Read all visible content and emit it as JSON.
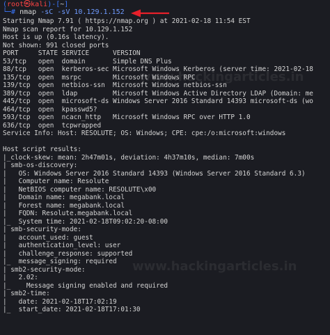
{
  "prompt": {
    "line1_open": "(",
    "user": "root㉿kali",
    "line1_mid": ")-[",
    "path": "~",
    "line1_close": "]",
    "line2_prefix": "└─# ",
    "command": "nmap",
    "args": " -sC -sV 10.129.1.152"
  },
  "colors": {
    "background": "#1b1c22",
    "text": "#d4d4d4",
    "prompt_blue": "#3b78ff",
    "prompt_user_red": "#ff4444",
    "arrow_red": "#e8202a"
  },
  "output_lines": [
    "Starting Nmap 7.91 ( https://nmap.org ) at 2021-02-18 11:54 EST",
    "Nmap scan report for 10.129.1.152",
    "Host is up (0.16s latency).",
    "Not shown: 991 closed ports",
    "PORT     STATE SERVICE      VERSION",
    "53/tcp   open  domain       Simple DNS Plus",
    "88/tcp   open  kerberos-sec Microsoft Windows Kerberos (server time: 2021-02-18",
    "135/tcp  open  msrpc        Microsoft Windows RPC",
    "139/tcp  open  netbios-ssn  Microsoft Windows netbios-ssn",
    "389/tcp  open  ldap         Microsoft Windows Active Directory LDAP (Domain: me",
    "445/tcp  open  microsoft-ds Windows Server 2016 Standard 14393 microsoft-ds (wo",
    "464/tcp  open  kpasswd5?",
    "593/tcp  open  ncacn_http   Microsoft Windows RPC over HTTP 1.0",
    "636/tcp  open  tcpwrapped",
    "Service Info: Host: RESOLUTE; OS: Windows; CPE: cpe:/o:microsoft:windows",
    "",
    "Host script results:",
    "|_clock-skew: mean: 2h47m01s, deviation: 4h37m10s, median: 7m00s",
    "| smb-os-discovery:",
    "|   OS: Windows Server 2016 Standard 14393 (Windows Server 2016 Standard 6.3)",
    "|   Computer name: Resolute",
    "|   NetBIOS computer name: RESOLUTE\\x00",
    "|   Domain name: megabank.local",
    "|   Forest name: megabank.local",
    "|   FQDN: Resolute.megabank.local",
    "|_  System time: 2021-02-18T09:02:20-08:00",
    "| smb-security-mode:",
    "|   account_used: guest",
    "|   authentication_level: user",
    "|   challenge_response: supported",
    "|_  message_signing: required",
    "| smb2-security-mode:",
    "|   2.02:",
    "|_    Message signing enabled and required",
    "| smb2-time:",
    "|   date: 2021-02-18T17:02:19",
    "|_  start_date: 2021-02-18T17:01:30"
  ],
  "watermark": {
    "text_1": "www.hackingarticles.in",
    "text_2": "www.hackingarticles.in"
  }
}
